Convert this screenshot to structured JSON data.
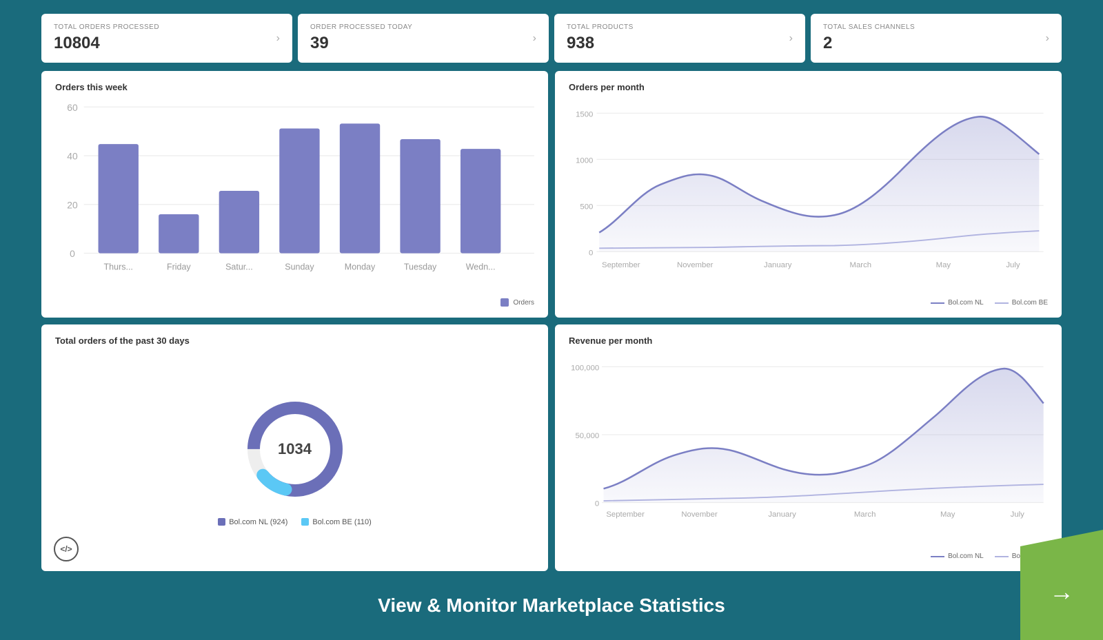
{
  "stats": [
    {
      "label": "TOTAL ORDERS PROCESSED",
      "value": "10804"
    },
    {
      "label": "ORDER PROCESSED TODAY",
      "value": "39"
    },
    {
      "label": "TOTAL PRODUCTS",
      "value": "938"
    },
    {
      "label": "TOTAL SALES CHANNELS",
      "value": "2"
    }
  ],
  "charts": {
    "orders_week": {
      "title": "Orders this week",
      "legend_label": "Orders",
      "bars": [
        {
          "day": "Thurs...",
          "value": 42
        },
        {
          "day": "Friday",
          "value": 15
        },
        {
          "day": "Satur...",
          "value": 24
        },
        {
          "day": "Sunday",
          "value": 48
        },
        {
          "day": "Monday",
          "value": 50
        },
        {
          "day": "Tuesday",
          "value": 44
        },
        {
          "day": "Wedn...",
          "value": 40
        }
      ],
      "y_max": 60,
      "y_labels": [
        60,
        40,
        20,
        0
      ]
    },
    "orders_month": {
      "title": "Orders per month",
      "x_labels": [
        "September",
        "November",
        "January",
        "March",
        "May",
        "July"
      ],
      "y_labels": [
        "1500",
        "1000",
        "500",
        "0"
      ],
      "legend": [
        {
          "label": "Bol.com NL",
          "color": "#7b7fc4"
        },
        {
          "label": "Bol.com BE",
          "color": "#b0b3e0"
        }
      ]
    },
    "orders_30days": {
      "title": "Total orders of the past 30 days",
      "donut_value": "1034",
      "nl_value": 924,
      "be_value": 110,
      "legend": [
        {
          "label": "Bol.com NL (924)",
          "color": "#6b6fb8"
        },
        {
          "label": "Bol.com BE (110)",
          "color": "#5bc8f5"
        }
      ]
    },
    "revenue_month": {
      "title": "Revenue per month",
      "x_labels": [
        "September",
        "November",
        "January",
        "March",
        "May",
        "July"
      ],
      "y_labels": [
        "100,000",
        "50,000",
        "0"
      ],
      "legend": [
        {
          "label": "Bol.com NL",
          "color": "#7b7fc4"
        },
        {
          "label": "Bol.com BE",
          "color": "#b0b3e0"
        }
      ]
    }
  },
  "bottom": {
    "text": "View & Monitor Marketplace Statistics"
  }
}
